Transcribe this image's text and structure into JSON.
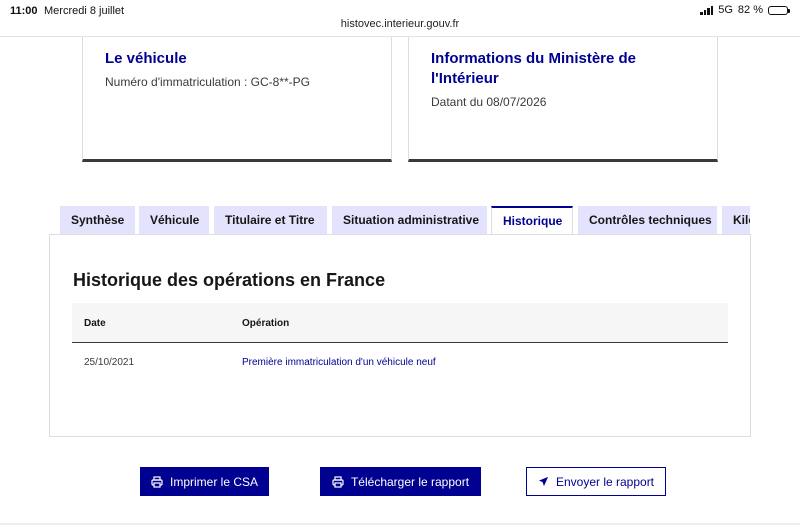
{
  "status_bar": {
    "time": "11:00",
    "date": "Mercredi 8 juillet",
    "network": "5G",
    "battery": "82 %"
  },
  "browser": {
    "url": "histovec.interieur.gouv.fr"
  },
  "cards": {
    "vehicle": {
      "title": "Le véhicule",
      "subtitle": "Numéro d'immatriculation : GC-8**-PG"
    },
    "ministry": {
      "title": "Informations du Ministère de l'Intérieur",
      "subtitle": "Datant du 08/07/2026"
    }
  },
  "tabs": [
    {
      "label": "Synthèse"
    },
    {
      "label": "Véhicule"
    },
    {
      "label": "Titulaire et Titre"
    },
    {
      "label": "Situation administrative"
    },
    {
      "label": "Historique"
    },
    {
      "label": "Contrôles techniques"
    },
    {
      "label": "Kilométrage"
    }
  ],
  "active_tab": "Historique",
  "history": {
    "title": "Historique des opérations en France",
    "columns": [
      "Date",
      "Opération"
    ],
    "rows": [
      {
        "date": "25/10/2021",
        "operation": "Première immatriculation d'un véhicule neuf"
      }
    ]
  },
  "actions": {
    "print": "Imprimer le CSA",
    "download": "Télécharger le rapport",
    "send": "Envoyer le rapport"
  },
  "colors": {
    "primary": "#000091",
    "tab_bg": "#e3e3fd",
    "text": "#161616"
  },
  "icons": {
    "print": "printer-icon",
    "download": "printer-icon",
    "send": "send-icon"
  }
}
